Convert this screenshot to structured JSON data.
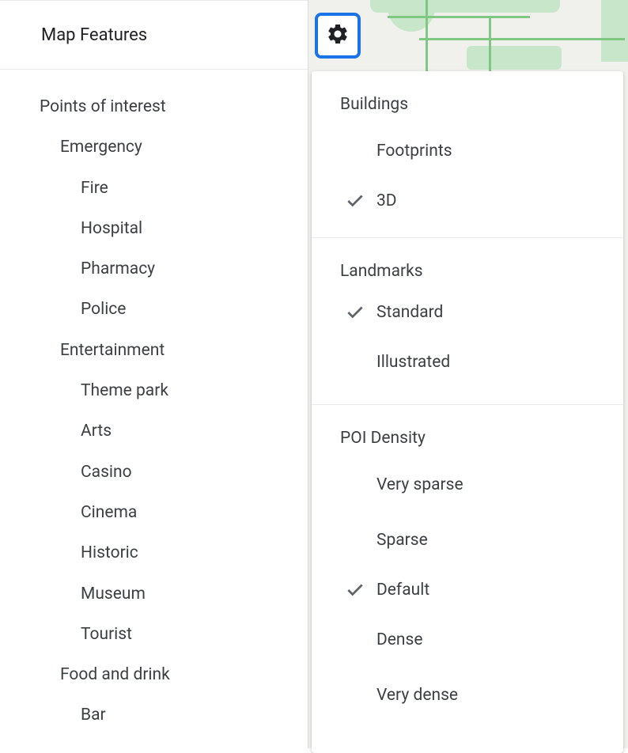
{
  "sidebar": {
    "title": "Map Features",
    "tree": [
      {
        "label": "Points of interest",
        "level": 0
      },
      {
        "label": "Emergency",
        "level": 1
      },
      {
        "label": "Fire",
        "level": 2
      },
      {
        "label": "Hospital",
        "level": 2
      },
      {
        "label": "Pharmacy",
        "level": 2
      },
      {
        "label": "Police",
        "level": 2
      },
      {
        "label": "Entertainment",
        "level": 1
      },
      {
        "label": "Theme park",
        "level": 2
      },
      {
        "label": "Arts",
        "level": 2
      },
      {
        "label": "Casino",
        "level": 2
      },
      {
        "label": "Cinema",
        "level": 2
      },
      {
        "label": "Historic",
        "level": 2
      },
      {
        "label": "Museum",
        "level": 2
      },
      {
        "label": "Tourist",
        "level": 2
      },
      {
        "label": "Food and drink",
        "level": 1
      },
      {
        "label": "Bar",
        "level": 2
      }
    ]
  },
  "popup": {
    "sections": [
      {
        "title": "Buildings",
        "options": [
          {
            "label": "Footprints",
            "checked": false
          },
          {
            "label": "3D",
            "checked": true
          }
        ]
      },
      {
        "title": "Landmarks",
        "options": [
          {
            "label": "Standard",
            "checked": true
          },
          {
            "label": "Illustrated",
            "checked": false
          }
        ]
      },
      {
        "title": "POI Density",
        "options": [
          {
            "label": "Very sparse",
            "checked": false
          },
          {
            "label": "Sparse",
            "checked": false
          },
          {
            "label": "Default",
            "checked": true
          },
          {
            "label": "Dense",
            "checked": false
          },
          {
            "label": "Very dense",
            "checked": false
          }
        ]
      }
    ]
  }
}
